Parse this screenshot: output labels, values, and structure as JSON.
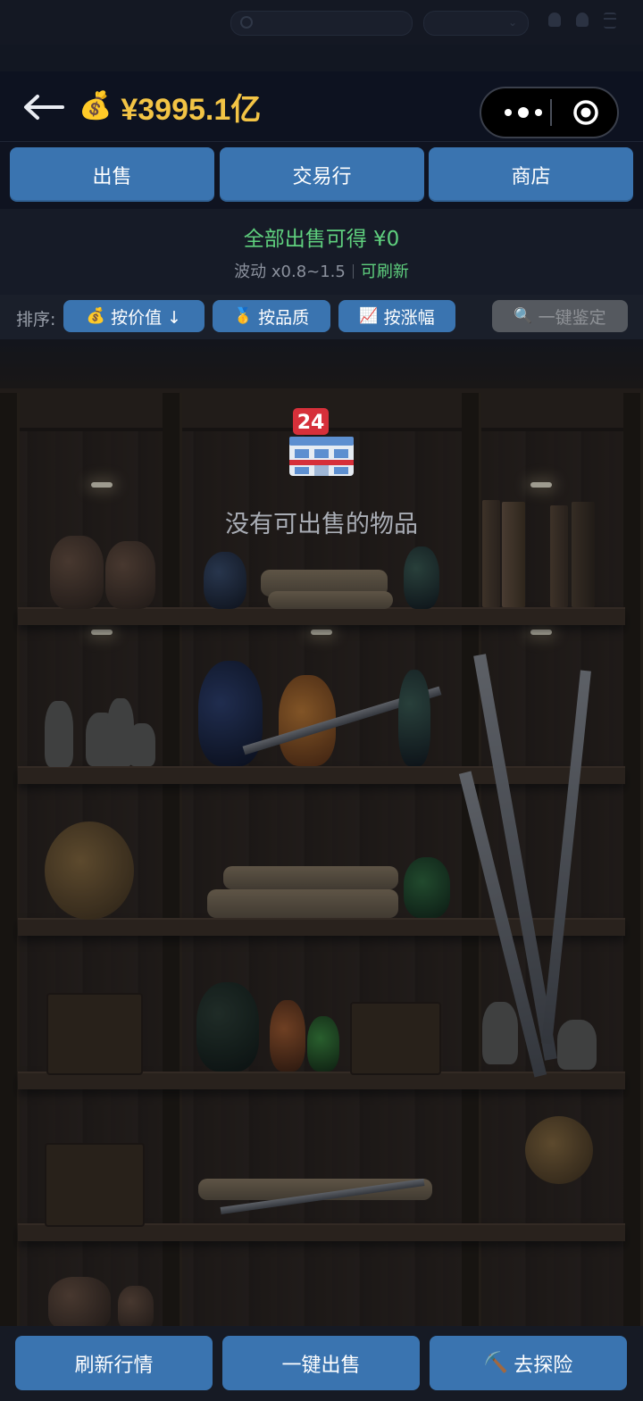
{
  "header": {
    "balance_icon": "money-bag-icon",
    "balance": "¥3995.1亿",
    "accent_color": "#f3c445"
  },
  "tabs": [
    {
      "label": "出售"
    },
    {
      "label": "交易行"
    },
    {
      "label": "商店"
    }
  ],
  "summary": {
    "title": "全部出售可得 ¥0",
    "fluctuation": "波动 x0.8~1.5",
    "refresh": "可刷新"
  },
  "sort": {
    "label": "排序:",
    "options": [
      {
        "icon": "💰",
        "label": "按价值 ↓"
      },
      {
        "icon": "🥇",
        "label": "按品质"
      },
      {
        "icon": "📈",
        "label": "按涨幅"
      }
    ],
    "identify": {
      "icon": "🔍",
      "label": "一键鉴定"
    }
  },
  "empty_state": {
    "icon": "convenience-store-icon",
    "icon_badge": "24",
    "message": "没有可出售的物品"
  },
  "bottom": [
    {
      "label": "刷新行情"
    },
    {
      "label": "一键出售"
    },
    {
      "icon": "⛏️",
      "label": "去探险"
    }
  ],
  "colors": {
    "button": "#3a74b0",
    "positive": "#5fd07e",
    "disabled": "#55595f"
  }
}
